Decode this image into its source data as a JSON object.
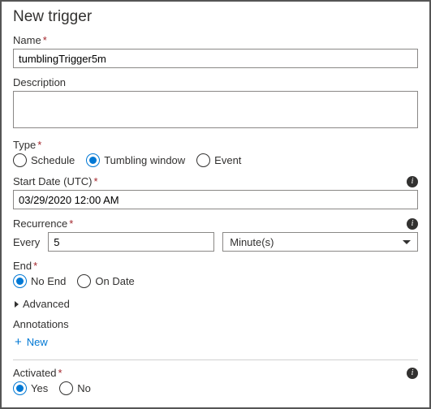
{
  "title": "New trigger",
  "name": {
    "label": "Name",
    "value": "tumblingTrigger5m"
  },
  "description": {
    "label": "Description",
    "value": ""
  },
  "type": {
    "label": "Type",
    "options": [
      "Schedule",
      "Tumbling window",
      "Event"
    ],
    "selected": "Tumbling window"
  },
  "startDate": {
    "label": "Start Date (UTC)",
    "value": "03/29/2020 12:00 AM"
  },
  "recurrence": {
    "label": "Recurrence",
    "everyLabel": "Every",
    "everyValue": "5",
    "unit": "Minute(s)"
  },
  "end": {
    "label": "End",
    "options": [
      "No End",
      "On Date"
    ],
    "selected": "No End"
  },
  "advanced": {
    "label": "Advanced"
  },
  "annotations": {
    "label": "Annotations",
    "newLabel": "New"
  },
  "activated": {
    "label": "Activated",
    "options": [
      "Yes",
      "No"
    ],
    "selected": "Yes"
  }
}
